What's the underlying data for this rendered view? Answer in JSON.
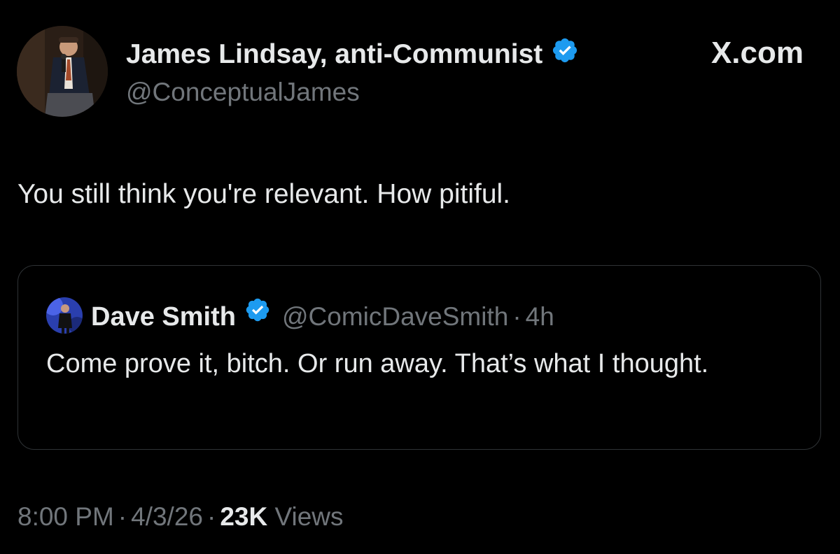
{
  "author": {
    "name": "James Lindsay, anti-Communist",
    "handle": "@ConceptualJames",
    "verified": true
  },
  "brand": "X.com",
  "tweet": {
    "text": "You still think you're relevant. How pitiful."
  },
  "quoted": {
    "name": "Dave Smith",
    "handle": "@ComicDaveSmith",
    "separator": "·",
    "time": "4h",
    "text": "Come prove it, bitch. Or run away. That’s what I thought.",
    "verified": true
  },
  "meta": {
    "time": "8:00 PM",
    "date": "4/3/26",
    "separator": "·",
    "views_count": "23K",
    "views_label": "Views"
  },
  "colors": {
    "background": "#000000",
    "primary_text": "#e7e9ea",
    "secondary_text": "#71767b",
    "verified_badge": "#1d9bf0",
    "card_border": "#2f3336"
  },
  "icons": {
    "verified": "verified-badge-icon"
  }
}
